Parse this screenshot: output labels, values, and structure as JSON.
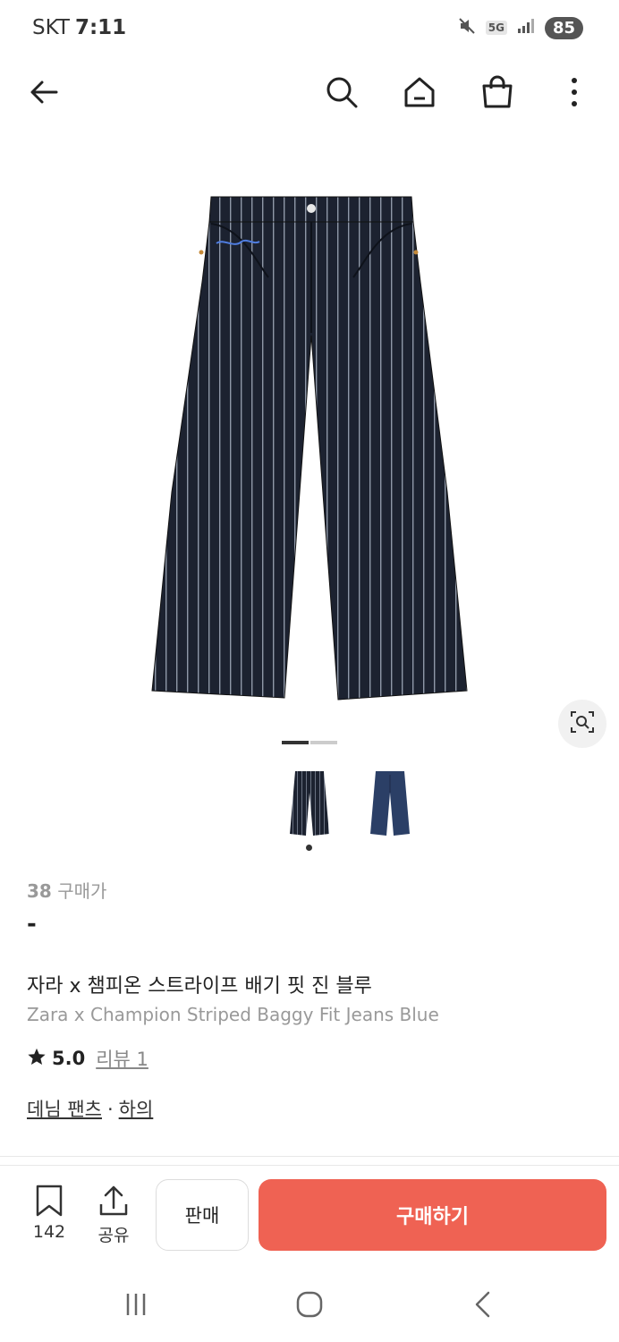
{
  "status_bar": {
    "carrier": "SKT",
    "time": "7:11",
    "network": "5G",
    "battery": "85"
  },
  "icons": {
    "back": "arrow-left-icon",
    "search": "search-icon",
    "home": "home-icon",
    "cart": "shopping-bag-icon",
    "more": "more-vertical-icon",
    "lens": "image-search-icon",
    "bookmark": "bookmark-icon",
    "share": "share-icon"
  },
  "gallery": {
    "indicator_total": 2,
    "indicator_active": 1,
    "thumbnails": [
      "striped-jeans-thumbnail",
      "blue-jeans-thumbnail"
    ]
  },
  "product": {
    "size": "38",
    "price_label": "구매가",
    "price": "-",
    "name_ko": "자라 x 챔피온 스트라이프 배기 핏 진 블루",
    "name_en": "Zara x Champion Striped Baggy Fit Jeans Blue",
    "rating": "5.0",
    "review_label": "리뷰 1",
    "category_1": "데님 팬츠",
    "category_sep": "·",
    "category_2": "하의"
  },
  "actions": {
    "bookmark_count": "142",
    "share_label": "공유",
    "sell_label": "판매",
    "buy_label": "구매하기"
  },
  "colors": {
    "buy_button": "#ef6253",
    "jeans_dark": "#1c2230",
    "jeans_blue": "#2b3f66"
  }
}
